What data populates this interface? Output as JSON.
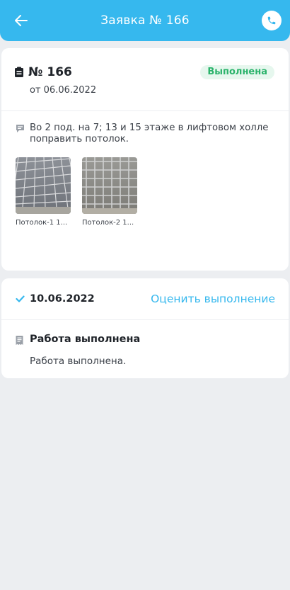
{
  "header": {
    "title": "Заявка № 166",
    "back_icon": "arrow-left-icon",
    "phone_icon": "phone-icon",
    "color": "#36b8ee"
  },
  "request": {
    "number": "№ 166",
    "date": "от 06.06.2022",
    "status": "Выполнена",
    "description": "Во 2 под. на 7;  13 и 15 этаже в лифтовом холле поправить потолок.",
    "attachments": [
      {
        "caption": "Потолок-1 1..."
      },
      {
        "caption": "Потолок-2 1..."
      }
    ]
  },
  "completion": {
    "date": "10.06.2022",
    "rate_link": "Оценить выполнение",
    "title": "Работа выполнена",
    "text": "Работа выполнена."
  },
  "colors": {
    "accent": "#36b8ee",
    "status_green": "#2bb36b",
    "status_bg": "#e6f7ee",
    "background": "#eceef1"
  }
}
